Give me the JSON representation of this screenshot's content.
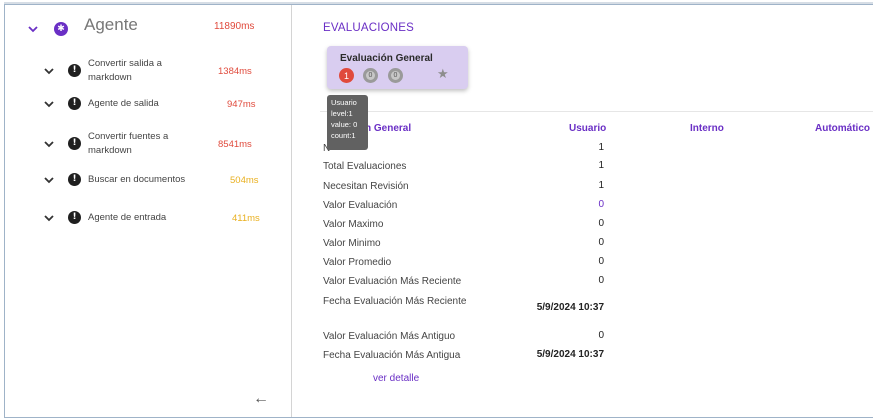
{
  "agent_tree": {
    "root": {
      "label": "Agente",
      "time": "11890ms",
      "icon": "agent-icon",
      "time_color": "#e04a3c"
    },
    "steps": [
      {
        "label": "Convertir salida a markdown",
        "time": "1384ms",
        "time_class": "red"
      },
      {
        "label": "Agente de salida",
        "time": "947ms",
        "time_class": "red"
      },
      {
        "label": "Convertir fuentes a markdown",
        "time": "8541ms",
        "time_class": "red"
      },
      {
        "label": "Buscar en documentos",
        "time": "504ms",
        "time_class": "orange"
      },
      {
        "label": "Agente de entrada",
        "time": "411ms",
        "time_class": "orange"
      }
    ],
    "back_icon": "arrow-left-icon"
  },
  "evaluations": {
    "section_title": "EVALUACIONES",
    "card": {
      "title": "Evaluación General",
      "badges": [
        "1",
        "0",
        "0"
      ],
      "star_icon": "star-icon"
    },
    "tooltip": [
      "Usuario",
      "level:1",
      "value: 0",
      "count:1"
    ],
    "table": {
      "headers": [
        "Evaluación General",
        "Usuario",
        "Interno",
        "Automático"
      ],
      "header_partial": "n General",
      "first_row_partial_label": "N",
      "rows": [
        {
          "label": "N",
          "value": "1"
        },
        {
          "label": "Total Evaluaciones",
          "value": "1"
        },
        {
          "label": "Necesitan Revisión",
          "value": "1"
        },
        {
          "label": "Valor Evaluación",
          "value": "0"
        },
        {
          "label": "Valor Maximo",
          "value": "0"
        },
        {
          "label": "Valor Minimo",
          "value": "0"
        },
        {
          "label": "Valor Promedio",
          "value": "0"
        },
        {
          "label": "Valor Evaluación Más Reciente",
          "value": "0"
        },
        {
          "label": "Fecha Evaluación Más Reciente",
          "value": "5/9/2024 10:37"
        },
        {
          "label": "Valor Evaluación Más Antiguo",
          "value": "0"
        },
        {
          "label": "Fecha Evaluación Más Antigua",
          "value": "5/9/2024 10:37"
        }
      ]
    },
    "detail_link": "ver detalle"
  },
  "colors": {
    "accent": "#6a2fc5",
    "time_red": "#e04a3c",
    "time_orange": "#e9b020",
    "card_bg": "#d9cdf0"
  }
}
